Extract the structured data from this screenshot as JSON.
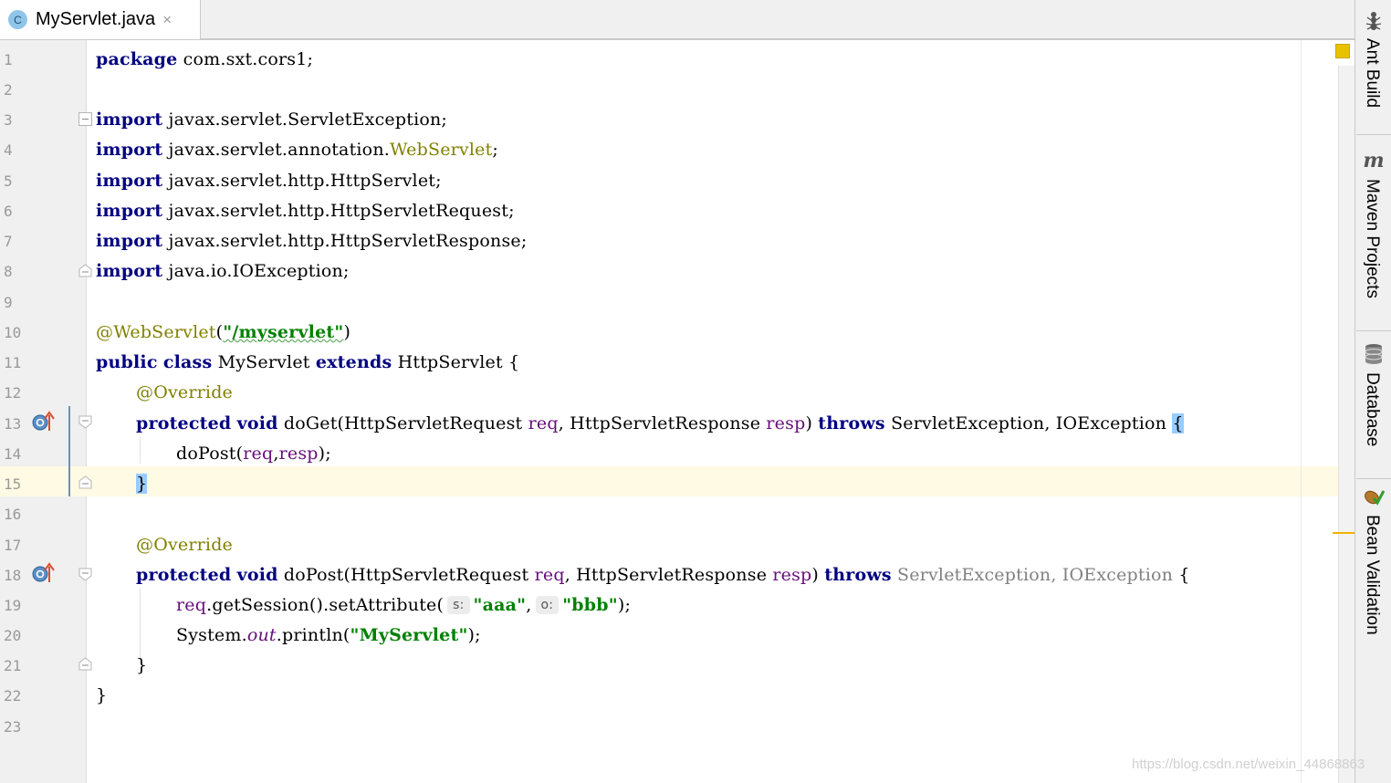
{
  "tab": {
    "icon_letter": "C",
    "filename": "MyServlet.java",
    "close": "×"
  },
  "lines": [
    {
      "n": "1"
    },
    {
      "n": "2"
    },
    {
      "n": "3"
    },
    {
      "n": "4"
    },
    {
      "n": "5"
    },
    {
      "n": "6"
    },
    {
      "n": "7"
    },
    {
      "n": "8"
    },
    {
      "n": "9"
    },
    {
      "n": "10"
    },
    {
      "n": "11"
    },
    {
      "n": "12"
    },
    {
      "n": "13"
    },
    {
      "n": "14"
    },
    {
      "n": "15"
    },
    {
      "n": "16"
    },
    {
      "n": "17"
    },
    {
      "n": "18"
    },
    {
      "n": "19"
    },
    {
      "n": "20"
    },
    {
      "n": "21"
    },
    {
      "n": "22"
    },
    {
      "n": "23"
    }
  ],
  "code": {
    "l1": {
      "kw": "package",
      "rest": " com.sxt.cors1;"
    },
    "import_kw": "import",
    "l3": " javax.servlet.ServletException;",
    "l4a": " javax.servlet.annotation.",
    "l4b": "WebServlet",
    "l4c": ";",
    "l5": " javax.servlet.http.HttpServlet;",
    "l6": " javax.servlet.http.HttpServletRequest;",
    "l7": " javax.servlet.http.HttpServletResponse;",
    "l8": " java.io.IOException;",
    "l10": {
      "ann": "@WebServlet",
      "open": "(",
      "str": "\"/myservlet\"",
      "close": ")"
    },
    "l11": {
      "kw1": "public",
      "kw2": "class",
      "name": " MyServlet ",
      "kw3": "extends",
      "rest": " HttpServlet {"
    },
    "override": "@Override",
    "l13": {
      "kw1": "protected",
      "kw2": "void",
      "name": " doGet(HttpServletRequest ",
      "p1": "req",
      "mid": ", HttpServletResponse ",
      "p2": "resp",
      "close": ") ",
      "throws": "throws",
      "exc": " ServletException, IOException ",
      "brace": "{"
    },
    "l14": {
      "call": "doPost(",
      "p1": "req",
      "comma": ",",
      "p2": "resp",
      "end": ");"
    },
    "l15": {
      "brace": "}"
    },
    "l18": {
      "kw1": "protected",
      "kw2": "void",
      "name": " doPost(HttpServletRequest ",
      "p1": "req",
      "mid": ", HttpServletResponse ",
      "p2": "resp",
      "close": ") ",
      "throws": "throws",
      "exc1": " ServletException",
      "comma": ",",
      "exc2": " IOException",
      "brace": " {"
    },
    "l19": {
      "p1": "req",
      "call": ".getSession().setAttribute(",
      "hint_s": "s:",
      "s1": "\"aaa\"",
      "comma": ",",
      "hint_o": "o:",
      "s2": "\"bbb\"",
      "end": ");"
    },
    "l20": {
      "cls": "System.",
      "field": "out",
      "call": ".println(",
      "str": "\"MyServlet\"",
      "end": ");"
    },
    "l21": "}",
    "l22": "}"
  },
  "tool_windows": [
    {
      "label": "Ant Build",
      "icon": "ant-icon"
    },
    {
      "label": "Maven Projects",
      "icon": "maven-icon"
    },
    {
      "label": "Database",
      "icon": "database-icon"
    },
    {
      "label": "Bean Validation",
      "icon": "bean-validation-icon"
    }
  ],
  "watermark": "https://blog.csdn.net/weixin_44868863",
  "colors": {
    "keyword": "#000080",
    "annotation": "#808000",
    "string": "#008000",
    "parameter": "#660e7a",
    "current_line": "#fffae3",
    "brace_match": "#99ccff"
  }
}
